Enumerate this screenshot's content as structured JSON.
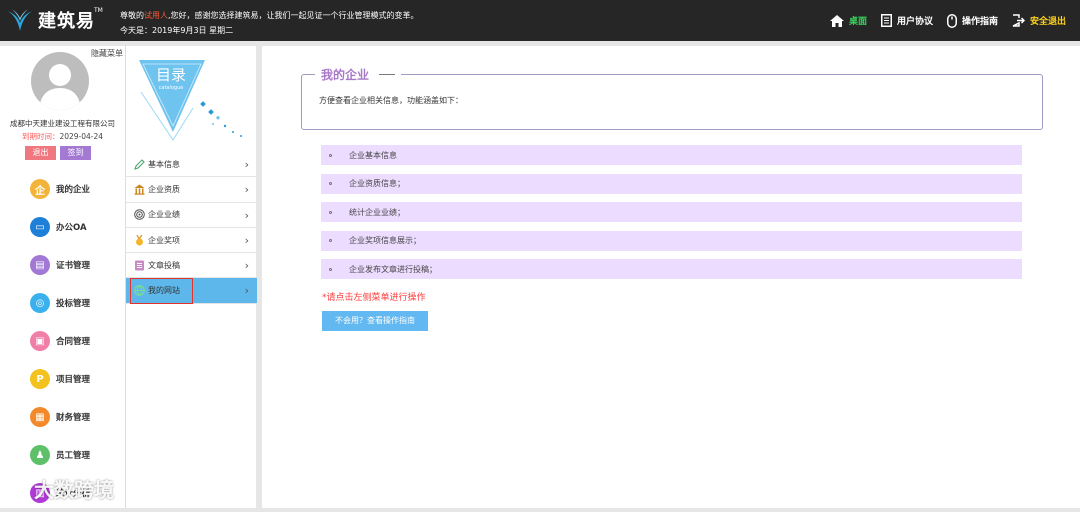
{
  "app": {
    "name": "建筑易",
    "tm": "TM"
  },
  "header": {
    "greeting_prefix": "尊敬的",
    "greeting_user": "试用人",
    "greeting_suffix": ",您好，感谢您选择建筑易，让我们一起见证一个行业管理模式的变革。",
    "date_line": "今天是：2019年9月3日 星期二"
  },
  "topnav": [
    {
      "label": "桌面",
      "icon": "home-icon"
    },
    {
      "label": "用户协议",
      "icon": "document-icon"
    },
    {
      "label": "操作指南",
      "icon": "mouse-icon"
    },
    {
      "label": "安全退出",
      "icon": "exit-icon"
    }
  ],
  "sidebar": {
    "hide_menu": "隐藏菜单",
    "company": "成都中天建业建设工程有限公司",
    "expire_label": "到期时间：",
    "expire_date": "2029-04-24",
    "logout": "退出",
    "sign_in": "签到",
    "items": [
      {
        "label": "我的企业",
        "icon": "enterprise-icon",
        "color": "#f2b43a",
        "glyph": "企"
      },
      {
        "label": "办公OA",
        "icon": "monitor-icon",
        "color": "#1e7fd8",
        "glyph": "▭"
      },
      {
        "label": "证书管理",
        "icon": "certificate-icon",
        "color": "#a179d4",
        "glyph": "▤"
      },
      {
        "label": "投标管理",
        "icon": "target-icon",
        "color": "#3ab1ec",
        "glyph": "◎"
      },
      {
        "label": "合同管理",
        "icon": "briefcase-icon",
        "color": "#f07fa8",
        "glyph": "▣"
      },
      {
        "label": "项目管理",
        "icon": "project-icon",
        "color": "#f4c21f",
        "glyph": "P"
      },
      {
        "label": "财务管理",
        "icon": "finance-icon",
        "color": "#f28a2c",
        "glyph": "▦"
      },
      {
        "label": "员工管理",
        "icon": "staff-icon",
        "color": "#5ec16a",
        "glyph": "♟"
      },
      {
        "label": "统计分析",
        "icon": "stats-icon",
        "color": "#b03ad6",
        "glyph": "▥"
      }
    ]
  },
  "catalog": {
    "title": "目录",
    "subtitle": "catalogue"
  },
  "submenu": [
    {
      "label": "基本信息",
      "icon": "pencil-icon"
    },
    {
      "label": "企业资质",
      "icon": "building-icon"
    },
    {
      "label": "企业业绩",
      "icon": "globe-icon"
    },
    {
      "label": "企业奖项",
      "icon": "medal-icon"
    },
    {
      "label": "文章投稿",
      "icon": "article-icon"
    },
    {
      "label": "我的网站",
      "icon": "website-icon",
      "active": true
    }
  ],
  "main": {
    "title": "我的企业",
    "intro": "方便查看企业相关信息，功能涵盖如下：",
    "features": [
      "企业基本信息",
      "企业资质信息；",
      "统计企业业绩；",
      "企业奖项信息展示；",
      "企业发布文章进行投稿；"
    ],
    "tip": "*请点击左侧菜单进行操作",
    "guide_button": "不会用？查看操作指南"
  },
  "watermark": "大数跨境",
  "colors": {
    "topbar": "#262626",
    "accent_purple": "#a879c8",
    "active_blue": "#5eb7ea",
    "feature_bg": "#ecdcff"
  }
}
